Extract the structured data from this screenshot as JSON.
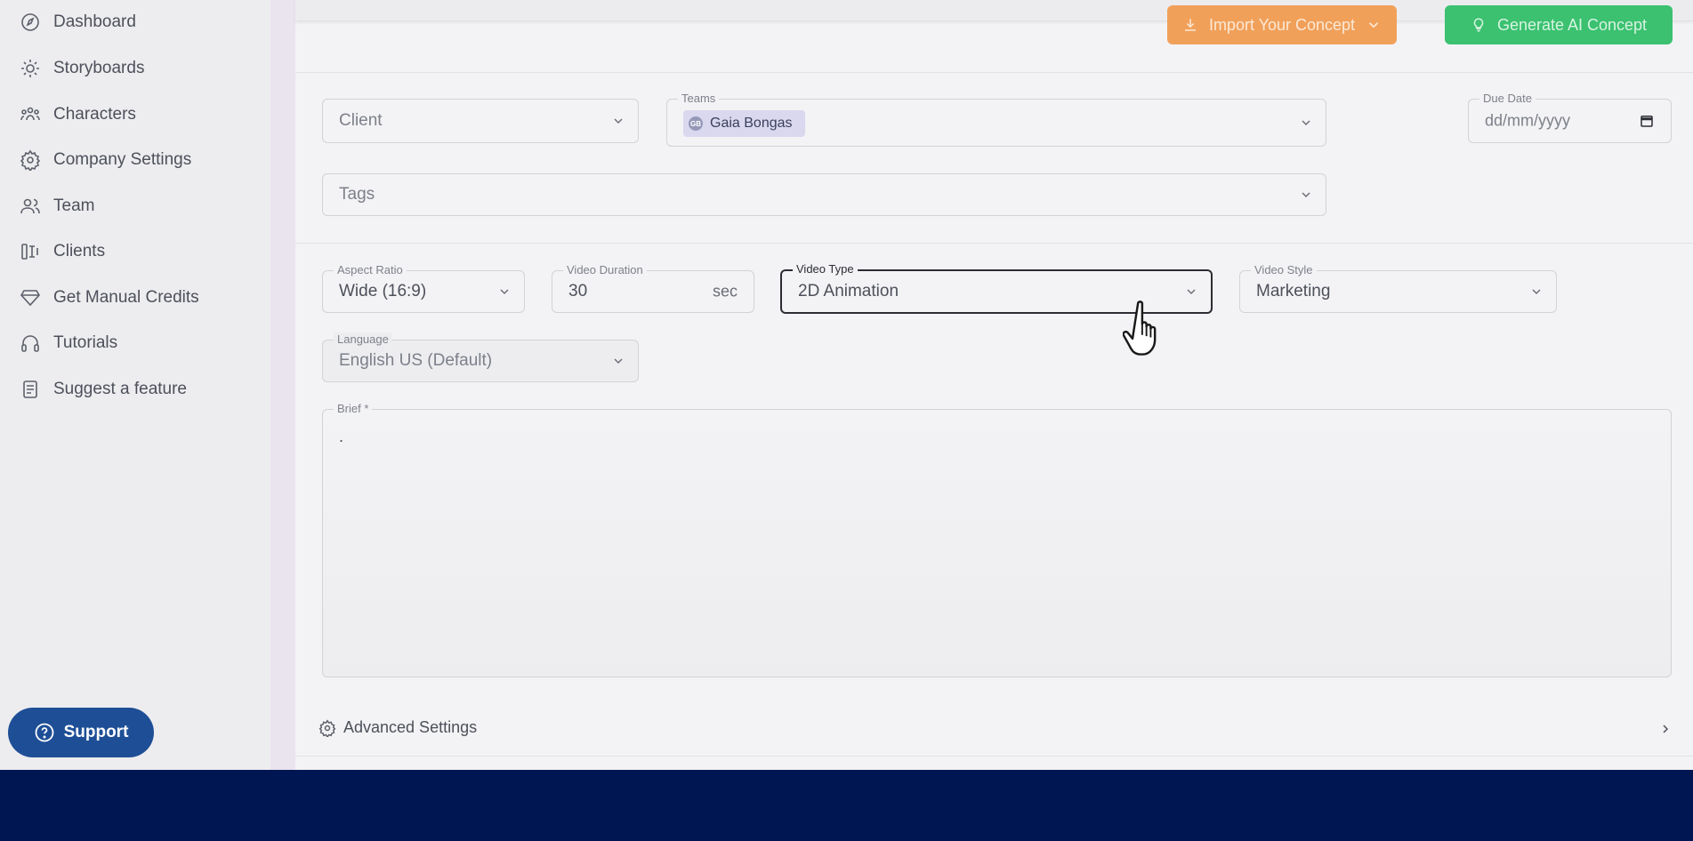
{
  "sidebar": {
    "items": [
      {
        "label": "Dashboard",
        "icon": "dashboard-icon"
      },
      {
        "label": "Storyboards",
        "icon": "storyboard-icon"
      },
      {
        "label": "Characters",
        "icon": "characters-icon"
      },
      {
        "label": "Company Settings",
        "icon": "gear-icon"
      },
      {
        "label": "Team",
        "icon": "team-icon"
      },
      {
        "label": "Clients",
        "icon": "clients-icon"
      },
      {
        "label": "Get Manual Credits",
        "icon": "diamond-icon"
      },
      {
        "label": "Tutorials",
        "icon": "headphones-icon"
      },
      {
        "label": "Suggest a feature",
        "icon": "document-icon"
      }
    ],
    "support_label": "Support"
  },
  "header": {
    "import_label": "Import Your Concept",
    "generate_label": "Generate AI Concept"
  },
  "form": {
    "client": {
      "placeholder": "Client"
    },
    "teams": {
      "label": "Teams",
      "chip_initials": "GB",
      "chip_label": "Gaia Bongas"
    },
    "due_date": {
      "label": "Due Date",
      "value": "dd/mm/yyyy"
    },
    "tags": {
      "placeholder": "Tags"
    },
    "aspect_ratio": {
      "label": "Aspect Ratio",
      "value": "Wide (16:9)"
    },
    "video_duration": {
      "label": "Video Duration",
      "value": "30",
      "unit": "sec"
    },
    "video_type": {
      "label": "Video Type",
      "value": "2D Animation"
    },
    "video_style": {
      "label": "Video Style",
      "value": "Marketing"
    },
    "language": {
      "label": "Language",
      "value": "English US (Default)"
    },
    "brief": {
      "label": "Brief *",
      "value": "."
    }
  },
  "advanced": {
    "label": "Advanced Settings"
  },
  "colors": {
    "import_button": "#f1a05a",
    "generate_button": "#3bc170",
    "support_button": "#1e4f96",
    "bottom_band": "#001652"
  }
}
